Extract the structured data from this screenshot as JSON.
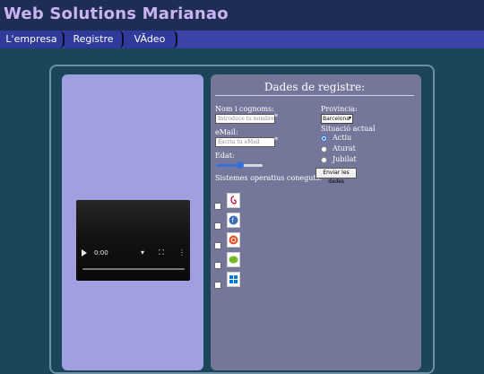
{
  "site": {
    "title": "Web Solutions Marianao"
  },
  "nav": {
    "items": [
      {
        "label": "L'empresa"
      },
      {
        "label": "Registre"
      },
      {
        "label": "VÃdeo"
      }
    ]
  },
  "video": {
    "time": "0:00"
  },
  "form": {
    "title": "Dades de registre:",
    "name_label": "Nom i cognoms:",
    "name_placeholder": "Introduce tu nombre y ap",
    "email_label": "eMail:",
    "email_placeholder": "Escriu tu eMail",
    "required_mark": "*",
    "age_label": "Edat:",
    "age_value_fraction": 0.52,
    "os_label": "Sistemes operatius coneguts:",
    "os_icons": [
      "debian-icon",
      "fedora-icon",
      "ubuntu-icon",
      "opensuse-icon",
      "windows-icon"
    ],
    "province_label": "Provincia:",
    "province_value": "Barcelona",
    "situation_label": "Situació actual",
    "situations": [
      {
        "label": "Actiu",
        "selected": true
      },
      {
        "label": "Aturat",
        "selected": false
      },
      {
        "label": "Jubilat",
        "selected": false
      }
    ],
    "submit_label": "Enviar les dades"
  }
}
